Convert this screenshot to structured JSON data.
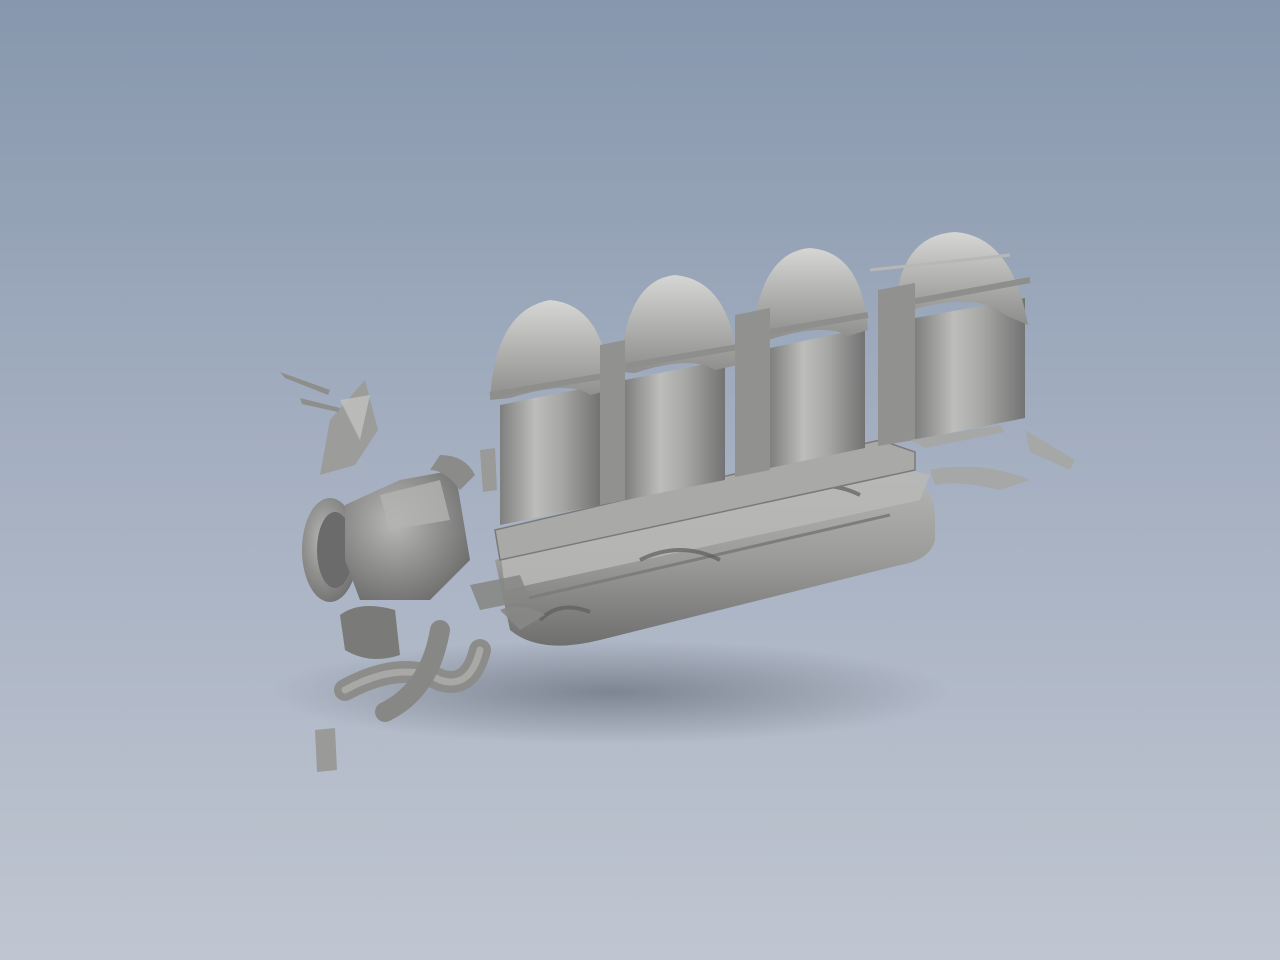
{
  "viewport": {
    "background_top": "#8797ad",
    "background_bottom": "#c0c6d1"
  },
  "model": {
    "surface_color": "#a3a3a1",
    "highlight_color": "#d2d2d0",
    "shade_color": "#6f706f",
    "shadow_color": "#6d7480"
  }
}
